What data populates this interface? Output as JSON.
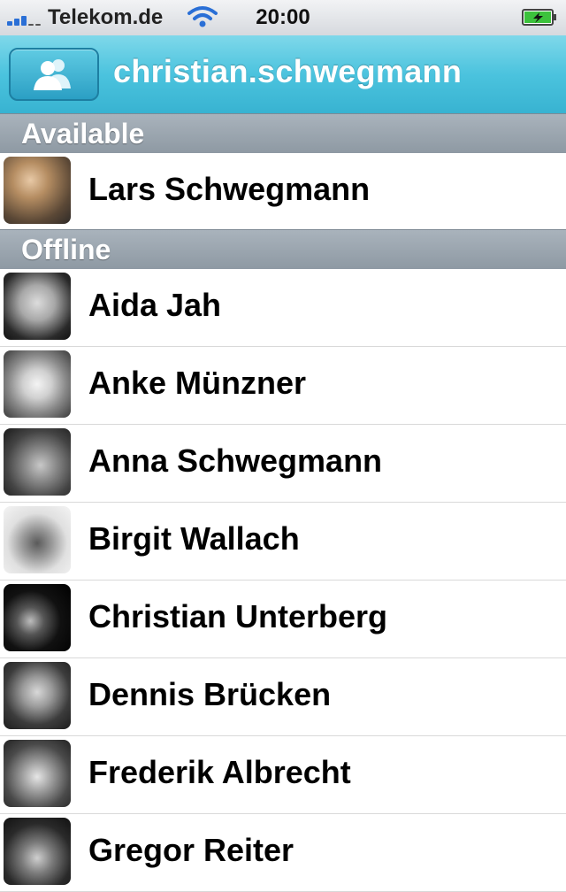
{
  "status_bar": {
    "carrier": "Telekom.de",
    "time": "20:00"
  },
  "nav": {
    "title": "christian.schwegmann",
    "contacts_button_icon": "people-icon"
  },
  "sections": {
    "available": "Available",
    "offline": "Offline"
  },
  "available_contacts": [
    {
      "name": "Lars Schwegmann"
    }
  ],
  "offline_contacts": [
    {
      "name": "Aida Jah"
    },
    {
      "name": "Anke Münzner"
    },
    {
      "name": "Anna Schwegmann"
    },
    {
      "name": "Birgit Wallach"
    },
    {
      "name": "Christian Unterberg"
    },
    {
      "name": "Dennis Brücken"
    },
    {
      "name": "Frederik Albrecht"
    },
    {
      "name": "Gregor Reiter"
    }
  ],
  "colors": {
    "nav_accent": "#38b3d1",
    "section_header": "#9aa4ae",
    "signal": "#2a6fd6",
    "battery": "#3cc23c"
  }
}
